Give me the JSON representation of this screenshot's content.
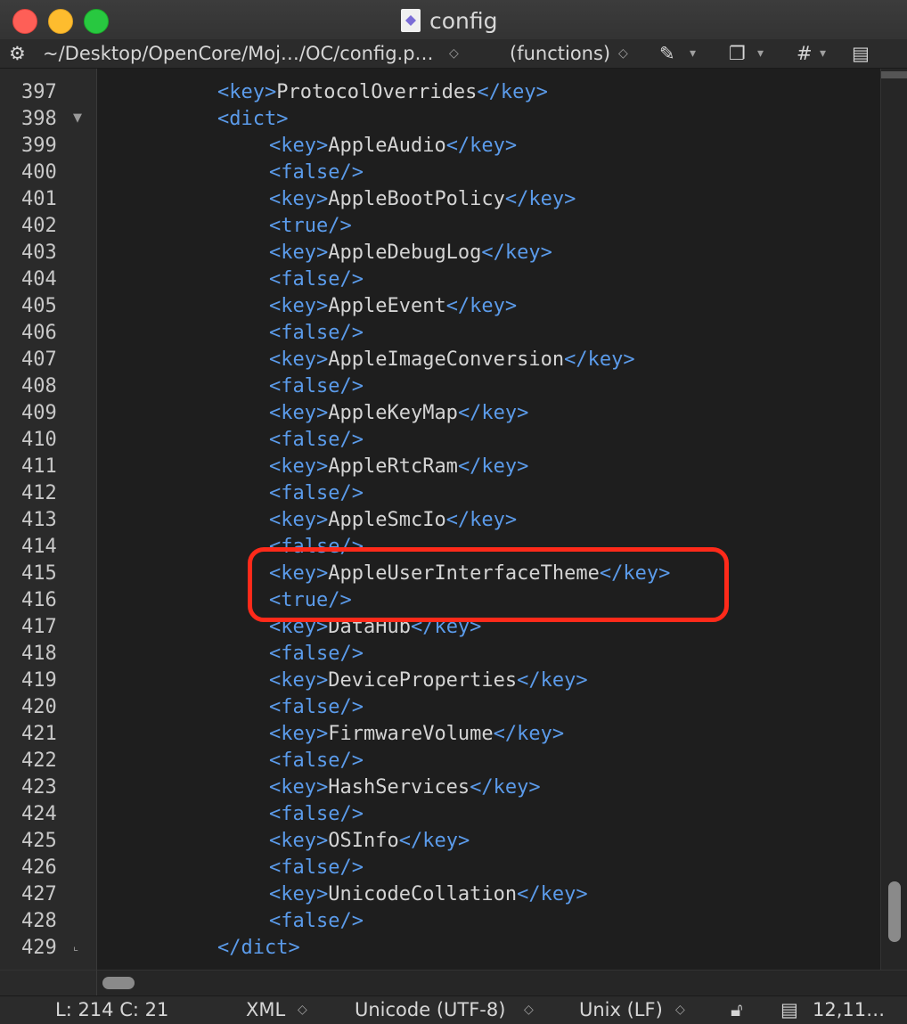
{
  "window": {
    "title": "config"
  },
  "toolbar": {
    "path": "~/Desktop/OpenCore/Moj…/OC/config.p…",
    "functions": "(functions)",
    "hash_label": "#"
  },
  "editor": {
    "lines": [
      {
        "n": "397",
        "indent": 2,
        "parts": [
          [
            "tag",
            "<key>"
          ],
          [
            "txt",
            "ProtocolOverrides"
          ],
          [
            "tag",
            "</key>"
          ]
        ]
      },
      {
        "n": "398",
        "indent": 2,
        "fold": "open",
        "parts": [
          [
            "tag",
            "<dict>"
          ]
        ]
      },
      {
        "n": "399",
        "indent": 3,
        "parts": [
          [
            "tag",
            "<key>"
          ],
          [
            "txt",
            "AppleAudio"
          ],
          [
            "tag",
            "</key>"
          ]
        ]
      },
      {
        "n": "400",
        "indent": 3,
        "parts": [
          [
            "tag",
            "<false/>"
          ]
        ]
      },
      {
        "n": "401",
        "indent": 3,
        "parts": [
          [
            "tag",
            "<key>"
          ],
          [
            "txt",
            "AppleBootPolicy"
          ],
          [
            "tag",
            "</key>"
          ]
        ]
      },
      {
        "n": "402",
        "indent": 3,
        "parts": [
          [
            "tag",
            "<true/>"
          ]
        ]
      },
      {
        "n": "403",
        "indent": 3,
        "parts": [
          [
            "tag",
            "<key>"
          ],
          [
            "txt",
            "AppleDebugLog"
          ],
          [
            "tag",
            "</key>"
          ]
        ]
      },
      {
        "n": "404",
        "indent": 3,
        "parts": [
          [
            "tag",
            "<false/>"
          ]
        ]
      },
      {
        "n": "405",
        "indent": 3,
        "parts": [
          [
            "tag",
            "<key>"
          ],
          [
            "txt",
            "AppleEvent"
          ],
          [
            "tag",
            "</key>"
          ]
        ]
      },
      {
        "n": "406",
        "indent": 3,
        "parts": [
          [
            "tag",
            "<false/>"
          ]
        ]
      },
      {
        "n": "407",
        "indent": 3,
        "parts": [
          [
            "tag",
            "<key>"
          ],
          [
            "txt",
            "AppleImageConversion"
          ],
          [
            "tag",
            "</key>"
          ]
        ]
      },
      {
        "n": "408",
        "indent": 3,
        "parts": [
          [
            "tag",
            "<false/>"
          ]
        ]
      },
      {
        "n": "409",
        "indent": 3,
        "parts": [
          [
            "tag",
            "<key>"
          ],
          [
            "txt",
            "AppleKeyMap"
          ],
          [
            "tag",
            "</key>"
          ]
        ]
      },
      {
        "n": "410",
        "indent": 3,
        "parts": [
          [
            "tag",
            "<false/>"
          ]
        ]
      },
      {
        "n": "411",
        "indent": 3,
        "parts": [
          [
            "tag",
            "<key>"
          ],
          [
            "txt",
            "AppleRtcRam"
          ],
          [
            "tag",
            "</key>"
          ]
        ]
      },
      {
        "n": "412",
        "indent": 3,
        "parts": [
          [
            "tag",
            "<false/>"
          ]
        ]
      },
      {
        "n": "413",
        "indent": 3,
        "parts": [
          [
            "tag",
            "<key>"
          ],
          [
            "txt",
            "AppleSmcIo"
          ],
          [
            "tag",
            "</key>"
          ]
        ]
      },
      {
        "n": "414",
        "indent": 3,
        "parts": [
          [
            "tag",
            "<false/>"
          ]
        ]
      },
      {
        "n": "415",
        "indent": 3,
        "parts": [
          [
            "tag",
            "<key>"
          ],
          [
            "txt",
            "AppleUserInterfaceTheme"
          ],
          [
            "tag",
            "</key>"
          ]
        ]
      },
      {
        "n": "416",
        "indent": 3,
        "parts": [
          [
            "tag",
            "<true/>"
          ]
        ]
      },
      {
        "n": "417",
        "indent": 3,
        "parts": [
          [
            "tag",
            "<key>"
          ],
          [
            "txt",
            "DataHub"
          ],
          [
            "tag",
            "</key>"
          ]
        ]
      },
      {
        "n": "418",
        "indent": 3,
        "parts": [
          [
            "tag",
            "<false/>"
          ]
        ]
      },
      {
        "n": "419",
        "indent": 3,
        "parts": [
          [
            "tag",
            "<key>"
          ],
          [
            "txt",
            "DeviceProperties"
          ],
          [
            "tag",
            "</key>"
          ]
        ]
      },
      {
        "n": "420",
        "indent": 3,
        "parts": [
          [
            "tag",
            "<false/>"
          ]
        ]
      },
      {
        "n": "421",
        "indent": 3,
        "parts": [
          [
            "tag",
            "<key>"
          ],
          [
            "txt",
            "FirmwareVolume"
          ],
          [
            "tag",
            "</key>"
          ]
        ]
      },
      {
        "n": "422",
        "indent": 3,
        "parts": [
          [
            "tag",
            "<false/>"
          ]
        ]
      },
      {
        "n": "423",
        "indent": 3,
        "parts": [
          [
            "tag",
            "<key>"
          ],
          [
            "txt",
            "HashServices"
          ],
          [
            "tag",
            "</key>"
          ]
        ]
      },
      {
        "n": "424",
        "indent": 3,
        "parts": [
          [
            "tag",
            "<false/>"
          ]
        ]
      },
      {
        "n": "425",
        "indent": 3,
        "parts": [
          [
            "tag",
            "<key>"
          ],
          [
            "txt",
            "OSInfo"
          ],
          [
            "tag",
            "</key>"
          ]
        ]
      },
      {
        "n": "426",
        "indent": 3,
        "parts": [
          [
            "tag",
            "<false/>"
          ]
        ]
      },
      {
        "n": "427",
        "indent": 3,
        "parts": [
          [
            "tag",
            "<key>"
          ],
          [
            "txt",
            "UnicodeCollation"
          ],
          [
            "tag",
            "</key>"
          ]
        ]
      },
      {
        "n": "428",
        "indent": 3,
        "parts": [
          [
            "tag",
            "<false/>"
          ]
        ]
      },
      {
        "n": "429",
        "indent": 2,
        "fold": "end",
        "parts": [
          [
            "tag",
            "</dict>"
          ]
        ]
      }
    ]
  },
  "status": {
    "position": "L: 214 C: 21",
    "syntax": "XML",
    "encoding": "Unicode (UTF-8)",
    "line_endings": "Unix (LF)",
    "stats": "12,11…"
  },
  "colors": {
    "tag": "#5b9bea",
    "text": "#d4d4d4",
    "highlight": "#ff2a1a",
    "background": "#1e1e1e"
  }
}
